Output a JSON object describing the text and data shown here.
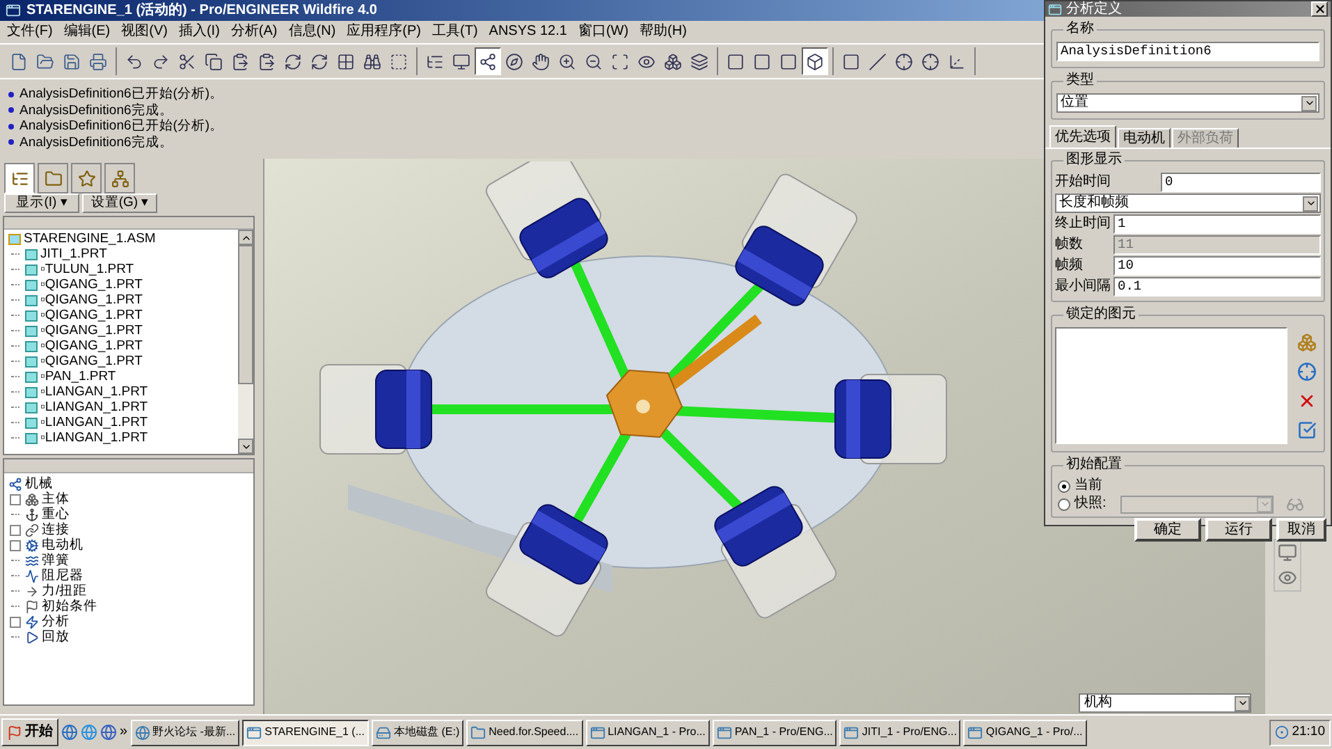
{
  "window": {
    "title": "STARENGINE_1 (活动的) - Pro/ENGINEER Wildfire 4.0"
  },
  "menu": [
    "文件(F)",
    "编辑(E)",
    "视图(V)",
    "插入(I)",
    "分析(A)",
    "信息(N)",
    "应用程序(P)",
    "工具(T)",
    "ANSYS 12.1",
    "窗口(W)",
    "帮助(H)"
  ],
  "toolbar": [
    [
      {
        "kind": "new",
        "pressed": false
      },
      {
        "kind": "open",
        "pressed": false
      },
      {
        "kind": "save",
        "pressed": false
      },
      {
        "kind": "print",
        "pressed": false
      }
    ],
    [
      {
        "kind": "undo",
        "pressed": false
      },
      {
        "kind": "redo",
        "pressed": false
      },
      {
        "kind": "cut",
        "pressed": false
      },
      {
        "kind": "copy",
        "pressed": false
      },
      {
        "kind": "paste",
        "pressed": false
      },
      {
        "kind": "paste",
        "pressed": false
      },
      {
        "kind": "regen",
        "pressed": false
      },
      {
        "kind": "regen",
        "pressed": false
      },
      {
        "kind": "grid",
        "pressed": false
      },
      {
        "kind": "find",
        "pressed": false
      },
      {
        "kind": "selectbox",
        "pressed": false
      }
    ],
    [
      {
        "kind": "tree",
        "pressed": false
      },
      {
        "kind": "repaint",
        "pressed": false
      },
      {
        "kind": "spin",
        "pressed": true
      },
      {
        "kind": "orient",
        "pressed": false
      },
      {
        "kind": "pan",
        "pressed": false
      },
      {
        "kind": "zoomin",
        "pressed": false
      },
      {
        "kind": "zoomout",
        "pressed": false
      },
      {
        "kind": "refit",
        "pressed": false
      },
      {
        "kind": "view",
        "pressed": false
      },
      {
        "kind": "views",
        "pressed": false
      },
      {
        "kind": "layers",
        "pressed": false
      }
    ],
    [
      {
        "kind": "wire",
        "pressed": false
      },
      {
        "kind": "wire",
        "pressed": false
      },
      {
        "kind": "wire",
        "pressed": false
      },
      {
        "kind": "shade",
        "pressed": true
      }
    ],
    [
      {
        "kind": "plane",
        "pressed": false
      },
      {
        "kind": "axis",
        "pressed": false
      },
      {
        "kind": "point",
        "pressed": false
      },
      {
        "kind": "point",
        "pressed": false
      },
      {
        "kind": "csys",
        "pressed": false
      }
    ]
  ],
  "messages": [
    "AnalysisDefinition6已开始(分析)。",
    "AnalysisDefinition6完成。",
    "AnalysisDefinition6已开始(分析)。",
    "AnalysisDefinition6完成。"
  ],
  "navigator_tabs": [
    {
      "kind": "tree",
      "selected": true
    },
    {
      "kind": "folder",
      "selected": false
    },
    {
      "kind": "favorites",
      "selected": false
    },
    {
      "kind": "connections",
      "selected": false
    }
  ],
  "tree_buttons": [
    "显示(I) ▾",
    "设置(G) ▾"
  ],
  "model_tree": {
    "label": "STARENGINE_1.ASM",
    "children": [
      {
        "label": "JITI_1.PRT"
      },
      {
        "label": "▫TULUN_1.PRT"
      },
      {
        "label": "▫QIGANG_1.PRT"
      },
      {
        "label": "▫QIGANG_1.PRT"
      },
      {
        "label": "▫QIGANG_1.PRT"
      },
      {
        "label": "▫QIGANG_1.PRT"
      },
      {
        "label": "▫QIGANG_1.PRT"
      },
      {
        "label": "▫QIGANG_1.PRT"
      },
      {
        "label": "▫PAN_1.PRT"
      },
      {
        "label": "▫LIANGAN_1.PRT"
      },
      {
        "label": "▫LIANGAN_1.PRT"
      },
      {
        "label": "▫LIANGAN_1.PRT"
      },
      {
        "label": "▫LIANGAN_1.PRT"
      }
    ]
  },
  "mechanism_tree": {
    "label": "机械",
    "children": [
      {
        "label": "主体",
        "kind": "body",
        "collapsed": true
      },
      {
        "label": "重心",
        "kind": "gravity",
        "collapsed": false
      },
      {
        "label": "连接",
        "kind": "joint",
        "collapsed": true
      },
      {
        "label": "电动机",
        "kind": "motor",
        "collapsed": true
      },
      {
        "label": "弹簧",
        "kind": "spring",
        "collapsed": false
      },
      {
        "label": "阻尼器",
        "kind": "damper",
        "collapsed": false
      },
      {
        "label": "力/扭距",
        "kind": "force",
        "collapsed": false
      },
      {
        "label": "初始条件",
        "kind": "initial",
        "collapsed": false
      },
      {
        "label": "分析",
        "kind": "analysis",
        "collapsed": true
      },
      {
        "label": "回放",
        "kind": "playback",
        "collapsed": false
      }
    ]
  },
  "dialog": {
    "title": "分析定义",
    "name_label": "名称",
    "name_value": "AnalysisDefinition6",
    "type_label": "类型",
    "type_value": "位置",
    "tabs": [
      {
        "label": "优先选项",
        "selected": true,
        "disabled": false
      },
      {
        "label": "电动机",
        "selected": false,
        "disabled": false
      },
      {
        "label": "外部负荷",
        "selected": false,
        "disabled": true
      }
    ],
    "graphics_label": "图形显示",
    "start_label": "开始时间",
    "start_value": "0",
    "mode_value": "长度和帧频",
    "fields": [
      {
        "label": "终止时间",
        "value": "1",
        "disabled": false
      },
      {
        "label": "帧数",
        "value": "11",
        "disabled": true
      },
      {
        "label": "帧频",
        "value": "10",
        "disabled": false
      },
      {
        "label": "最小间隔",
        "value": "0.1",
        "disabled": false
      }
    ],
    "locked_label": "锁定的图元",
    "locked_tools": [
      {
        "kind": "body"
      },
      {
        "kind": "point"
      },
      {
        "kind": "delete"
      },
      {
        "kind": "check"
      }
    ],
    "initial_label": "初始配置",
    "radios": [
      {
        "label": "当前",
        "selected": true
      },
      {
        "label": "快照:",
        "selected": false
      }
    ],
    "buttons": [
      "确定",
      "运行",
      "取消"
    ]
  },
  "status_combo": "机构",
  "taskbar": {
    "start": "开始",
    "chevron": "»",
    "items": [
      {
        "label": "野火论坛 -最新...",
        "kind": "browser",
        "selected": false
      },
      {
        "label": "STARENGINE_1 (...",
        "kind": "app",
        "selected": true
      },
      {
        "label": "本地磁盘 (E:)",
        "kind": "drive",
        "selected": false
      },
      {
        "label": "Need.for.Speed....",
        "kind": "folder",
        "selected": false
      },
      {
        "label": "LIANGAN_1 - Pro...",
        "kind": "app",
        "selected": false
      },
      {
        "label": "PAN_1 - Pro/ENG...",
        "kind": "app",
        "selected": false
      },
      {
        "label": "JITI_1 - Pro/ENG...",
        "kind": "app",
        "selected": false
      },
      {
        "label": "QIGANG_1 - Pro/...",
        "kind": "app",
        "selected": false
      }
    ],
    "clock": "21:10"
  }
}
